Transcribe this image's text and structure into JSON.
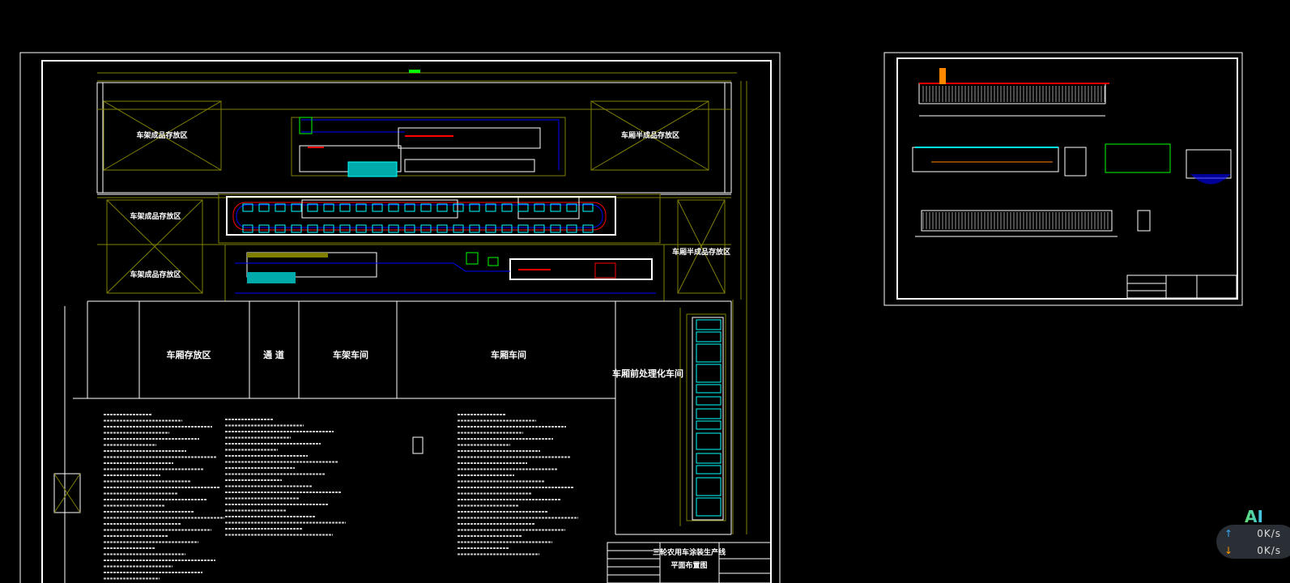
{
  "drawing": {
    "title_block": {
      "title": "三轮农用车涂装生产线",
      "subtitle": "平面布置图"
    },
    "areas": {
      "top_left": "车架成品存放区",
      "top_right": "车厢半成品存放区",
      "mid_left_1": "车架成品存放区",
      "mid_left_2": "车架成品存放区",
      "mid_right": "车厢半成品存放区",
      "bay_1": "车厢存放区",
      "bay_2": "通  道",
      "bay_3": "车架车间",
      "bay_4": "车厢车间",
      "bay_5": "车厢前处理化车间"
    },
    "colors": {
      "background": "#000000",
      "frame": "#ffffff",
      "grid": "#808000",
      "conveyor": "#0000ff",
      "equipment": "#ff0000",
      "accent": "#00ff00",
      "cyan": "#00ffff"
    }
  },
  "network_widget": {
    "logo": "AI",
    "upload": "0K/s",
    "download": "0K/s",
    "upload_icon": "arrow-up",
    "download_icon": "arrow-down"
  }
}
